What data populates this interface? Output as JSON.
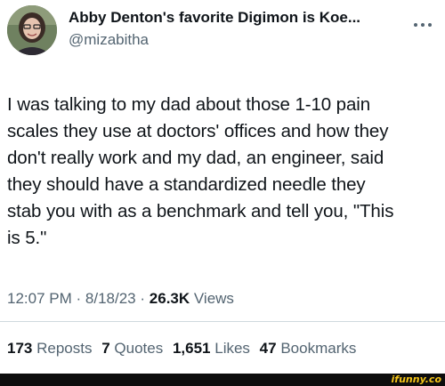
{
  "author": {
    "display_name": "Abby Denton's favorite Digimon is Koe...",
    "handle": "@mizabitha",
    "avatar_icon": "profile-photo"
  },
  "more_icon": "more-horizontal-icon",
  "tweet": {
    "lines": [
      "I was talking to my dad about those 1-10 pain",
      "scales they use at doctors' offices and how they",
      "don't really work and my dad, an engineer, said",
      "they should have a standardized needle they",
      "stab you with as a benchmark and tell you, \"This",
      "is 5.\""
    ]
  },
  "meta": {
    "time": "12:07 PM",
    "separator": "·",
    "date": "8/18/23",
    "views_count": "26.3K",
    "views_label": "Views"
  },
  "stats": {
    "reposts_count": "173",
    "reposts_label": "Reposts",
    "quotes_count": "7",
    "quotes_label": "Quotes",
    "likes_count": "1,651",
    "likes_label": "Likes",
    "bookmarks_count": "47",
    "bookmarks_label": "Bookmarks"
  },
  "watermark": "ifunny.co",
  "colors": {
    "text": "#0f1419",
    "secondary": "#536471",
    "divider": "#cfd9de",
    "watermark": "#f5c518"
  }
}
